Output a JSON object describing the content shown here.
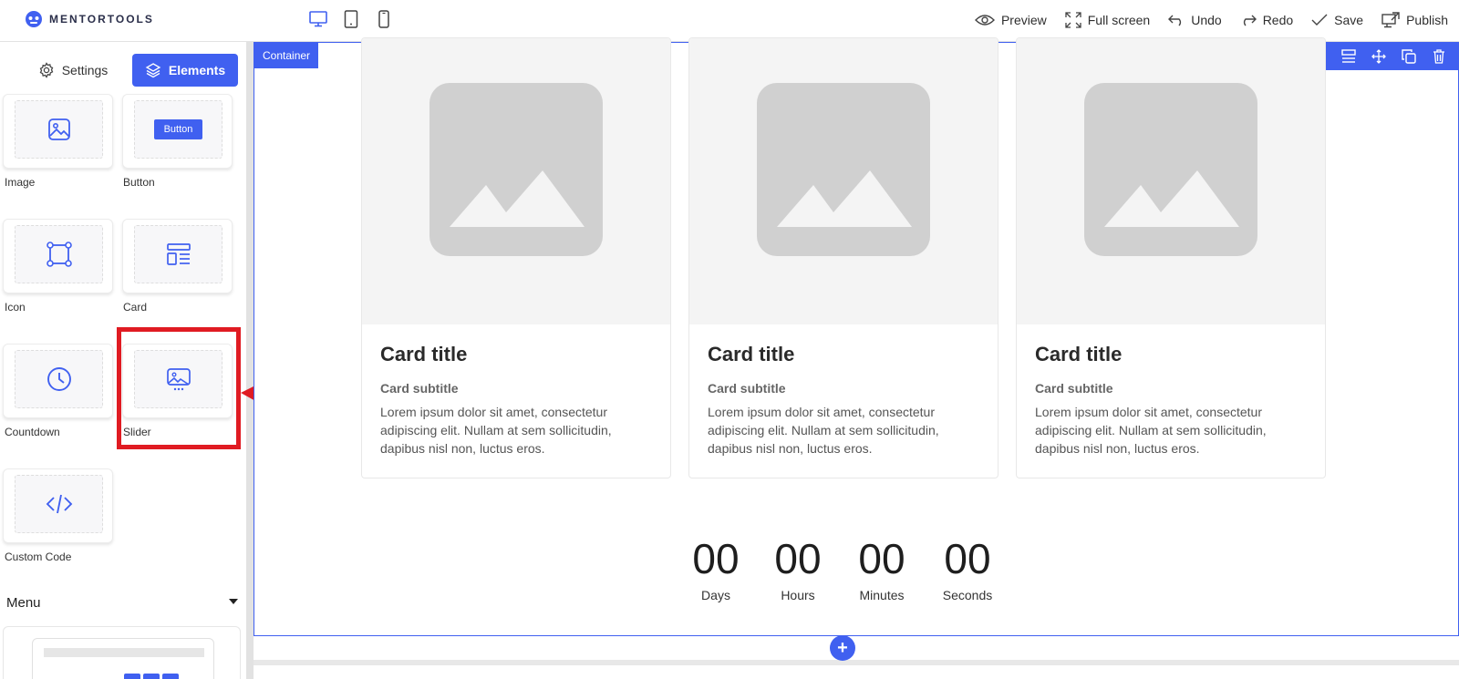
{
  "brand": {
    "name": "MENTORTOOLS",
    "color": "#4060f0"
  },
  "topbar": {
    "devices": [
      "desktop-icon",
      "tablet-icon",
      "mobile-icon"
    ],
    "actions": [
      {
        "label": "Preview",
        "icon": "eye-icon"
      },
      {
        "label": "Full screen",
        "icon": "fullscreen-icon"
      },
      {
        "label": "Undo",
        "icon": "undo-icon"
      },
      {
        "label": "Redo",
        "icon": "redo-icon"
      },
      {
        "label": "Save",
        "icon": "check-icon"
      },
      {
        "label": "Publish",
        "icon": "publish-icon"
      }
    ]
  },
  "sidebar": {
    "tabs": {
      "settings": "Settings",
      "elements": "Elements"
    },
    "elements": [
      {
        "label": "Image",
        "icon": "image-icon"
      },
      {
        "label": "Button",
        "icon": "button-preview",
        "preview_text": "Button"
      },
      {
        "label": "Icon",
        "icon": "vector-square-icon"
      },
      {
        "label": "Card",
        "icon": "card-layout-icon"
      },
      {
        "label": "Countdown",
        "icon": "clock-icon"
      },
      {
        "label": "Slider",
        "icon": "slider-icon"
      },
      {
        "label": "Custom Code",
        "icon": "code-icon"
      }
    ],
    "menu_section": "Menu"
  },
  "annotation": {
    "color": "#e01b22",
    "target": "Slider"
  },
  "canvas": {
    "container_label": "Container",
    "tools": [
      "gear-icon",
      "align-icon",
      "move-icon",
      "copy-icon",
      "trash-icon"
    ],
    "cards": [
      {
        "title": "Card title",
        "subtitle": "Card subtitle",
        "text": "Lorem ipsum dolor sit amet, consectetur adipiscing elit. Nullam at sem sollicitudin, dapibus nisl non, luctus eros."
      },
      {
        "title": "Card title",
        "subtitle": "Card subtitle",
        "text": "Lorem ipsum dolor sit amet, consectetur adipiscing elit. Nullam at sem sollicitudin, dapibus nisl non, luctus eros."
      },
      {
        "title": "Card title",
        "subtitle": "Card subtitle",
        "text": "Lorem ipsum dolor sit amet, consectetur adipiscing elit. Nullam at sem sollicitudin, dapibus nisl non, luctus eros."
      }
    ],
    "countdown": [
      {
        "value": "00",
        "label": "Days"
      },
      {
        "value": "00",
        "label": "Hours"
      },
      {
        "value": "00",
        "label": "Minutes"
      },
      {
        "value": "00",
        "label": "Seconds"
      }
    ],
    "add_button": "+"
  }
}
